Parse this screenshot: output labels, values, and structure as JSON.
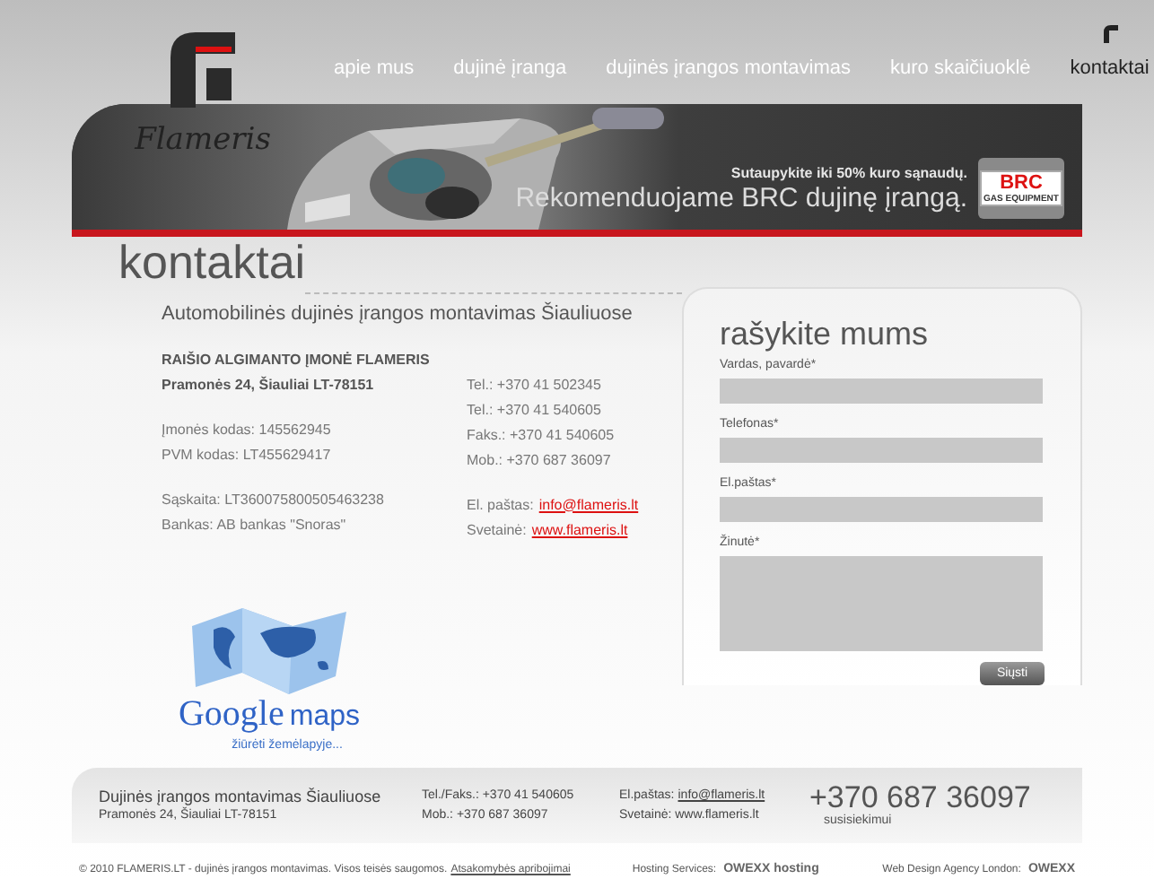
{
  "logo": {
    "name": "Flameris"
  },
  "nav": [
    {
      "label": "apie mus",
      "selected": false
    },
    {
      "label": "dujinė įranga",
      "selected": false
    },
    {
      "label": "dujinės įrangos montavimas",
      "selected": false
    },
    {
      "label": "kuro skaičiuoklė",
      "selected": false
    },
    {
      "label": "kontaktai",
      "selected": true
    }
  ],
  "banner": {
    "tagline": "Sutaupykite iki 50% kuro sąnaudų.",
    "headline": "Rekomenduojame BRC dujinę įrangą.",
    "badge": "BRC",
    "badge_caption": "GAS EQUIPMENT"
  },
  "page_title": "kontaktai",
  "subtitle": "Automobilinės dujinės įrangos montavimas Šiauliuose",
  "company": {
    "name": "RAIŠIO ALGIMANTO ĮMONĖ FLAMERIS",
    "address": "Pramonės 24, Šiauliai LT-78151"
  },
  "codes": [
    "Įmonės kodas: 145562945",
    "PVM kodas: LT455629417"
  ],
  "bank": [
    "Sąskaita: LT360075800505463238",
    "Bankas: AB bankas \"Snoras\""
  ],
  "phones": [
    "Tel.: +370 41 502345",
    "Tel.: +370 41 540605",
    "Faks.: +370 41 540605",
    "Mob.: +370 687 36097"
  ],
  "links": [
    {
      "label": "El. paštas:",
      "link": "info@flameris.lt"
    },
    {
      "label": "Svetainė:",
      "link": "www.flameris.lt"
    }
  ],
  "form": {
    "title": "rašykite mums",
    "fields": [
      {
        "label": "Vardas, pavardė*",
        "kind": "text"
      },
      {
        "label": "Telefonas*",
        "kind": "text"
      },
      {
        "label": "El.paštas*",
        "kind": "text"
      },
      {
        "label": "Žinutė*",
        "kind": "textarea"
      }
    ],
    "submit": "Siųsti"
  },
  "map": {
    "brand": "Google",
    "product": "maps",
    "link": "žiūrėti žemėlapyje..."
  },
  "footer": {
    "title": "Dujinės įrangos montavimas Šiauliuose",
    "address": "Pramonės 24, Šiauliai LT-78151",
    "phones": [
      "Tel./Faks.: +370 41 540605",
      "Mob.: +370 687 36097"
    ],
    "email_label": "El.paštas:",
    "email": "info@flameris.lt",
    "site": "Svetainė: www.flameris.lt",
    "big_phone": "+370 687 36097",
    "big_phone_caption": "susisiekimui"
  },
  "bottom": {
    "copyright": "© 2010 FLAMERIS.LT - dujinės įrangos montavimas. Visos teisės saugomos.",
    "policy": "Atsakomybės apribojimai",
    "hosting_label": "Hosting Services:",
    "hosting_brand": "OWEXX hosting",
    "agency_label": "Web Design Agency London:",
    "agency_brand": "OWEXX"
  }
}
